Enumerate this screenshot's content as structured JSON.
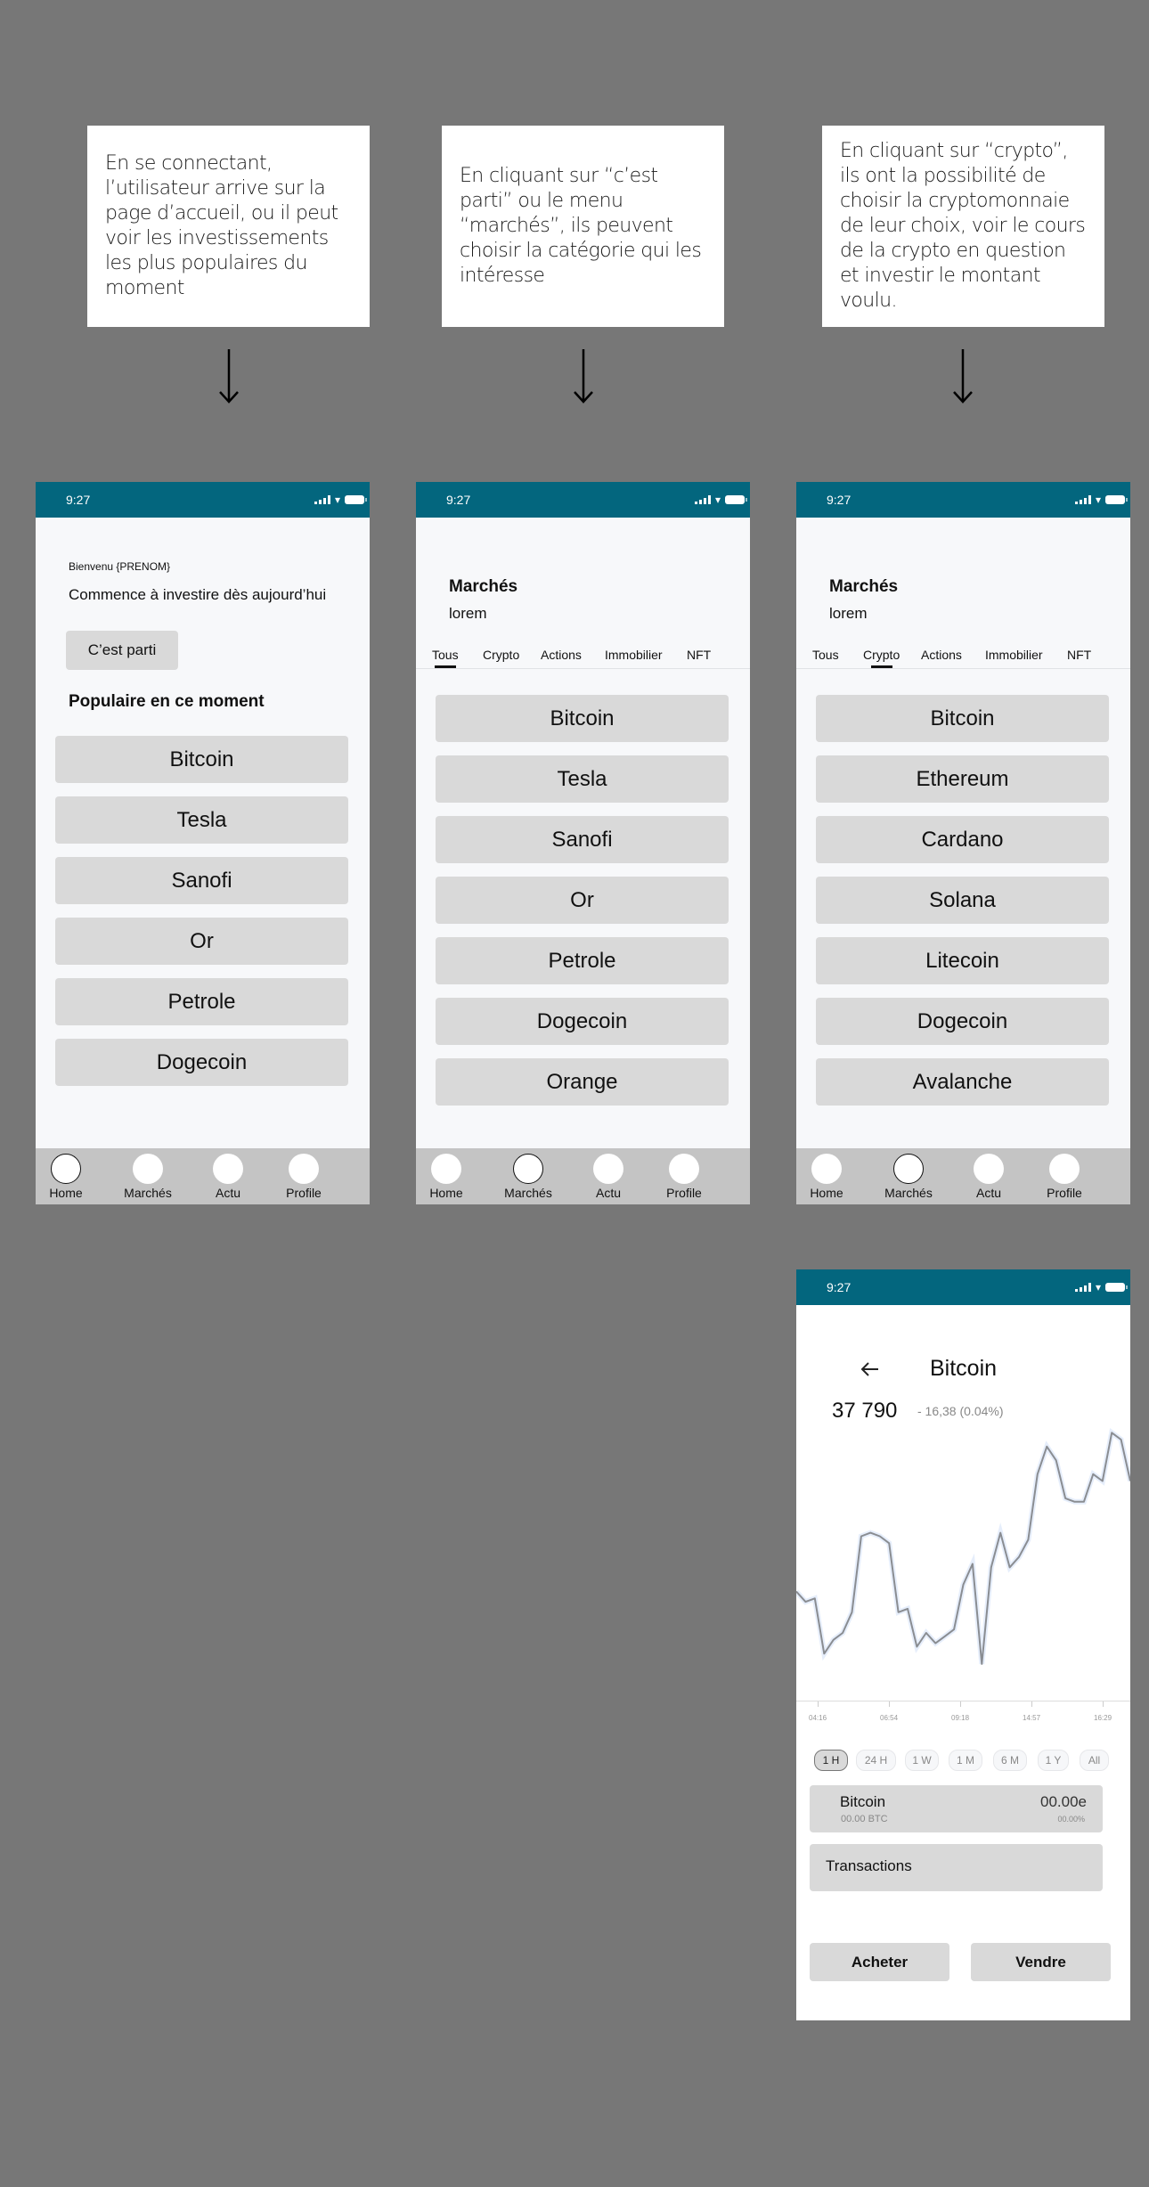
{
  "captions": [
    "En se connectant, l’utilisateur arrive sur la page d’accueil, ou il peut voir les investissements les plus populaires du moment",
    "En cliquant sur “c’est parti” ou le menu “marchés”, ils peuvent choisir la catégorie qui les intéresse",
    "En cliquant sur “crypto”, ils ont la possibilité de choisir la cryptomonnaie de leur choix, voir le cours de la crypto en question et investir le montant voulu."
  ],
  "status_bar": {
    "time": "9:27"
  },
  "nav": [
    "Home",
    "Marchés",
    "Actu",
    "Profile"
  ],
  "home": {
    "welcome": "Bienvenu {PRENOM}",
    "tagline": "Commence à investire dès aujourd’hui",
    "cta_label": "C’est parti",
    "section_title": "Populaire en ce moment",
    "items": [
      "Bitcoin",
      "Tesla",
      "Sanofi",
      "Or",
      "Petrole",
      "Dogecoin"
    ],
    "active_nav": "Home"
  },
  "markets": {
    "title": "Marchés",
    "subtitle": "lorem",
    "tabs": [
      "Tous",
      "Crypto",
      "Actions",
      "Immobilier",
      "NFT"
    ],
    "active_tab": "Tous",
    "items": [
      "Bitcoin",
      "Tesla",
      "Sanofi",
      "Or",
      "Petrole",
      "Dogecoin",
      "Orange"
    ],
    "active_nav": "Marchés"
  },
  "crypto": {
    "title": "Marchés",
    "subtitle": "lorem",
    "tabs": [
      "Tous",
      "Crypto",
      "Actions",
      "Immobilier",
      "NFT"
    ],
    "active_tab": "Crypto",
    "items": [
      "Bitcoin",
      "Ethereum",
      "Cardano",
      "Solana",
      "Litecoin",
      "Dogecoin",
      "Avalanche"
    ],
    "active_nav": "Marchés"
  },
  "detail": {
    "back_icon": "arrow-left-icon",
    "title": "Bitcoin",
    "price": "37 790",
    "change": "- 16,38 (0.04%)",
    "ranges": [
      "1 H",
      "24 H",
      "1 W",
      "1 M",
      "6 M",
      "1 Y",
      "All"
    ],
    "active_range": "1 H",
    "holding": {
      "name": "Bitcoin",
      "amount": "00.00 BTC",
      "value": "00.00e",
      "percent": "00.00%"
    },
    "transactions_label": "Transactions",
    "buy_label": "Acheter",
    "sell_label": "Vendre"
  },
  "chart_data": {
    "type": "line",
    "title": "",
    "xlabel": "",
    "ylabel": "",
    "x_ticks": [
      "04:16",
      "06:54",
      "09:18",
      "14:57",
      "16:29"
    ],
    "grid": false,
    "line_color": "#8a8d92",
    "series": [
      {
        "name": "Bitcoin",
        "values": [
          58,
          55,
          56,
          40,
          44,
          46,
          52,
          74,
          75,
          74,
          72,
          52,
          53,
          42,
          46,
          43,
          45,
          47,
          60,
          66,
          37,
          65,
          75,
          65,
          68,
          73,
          92,
          100,
          96,
          85,
          84,
          84,
          92,
          90,
          104,
          102,
          90
        ]
      }
    ],
    "ylim": [
      30,
      110
    ]
  }
}
